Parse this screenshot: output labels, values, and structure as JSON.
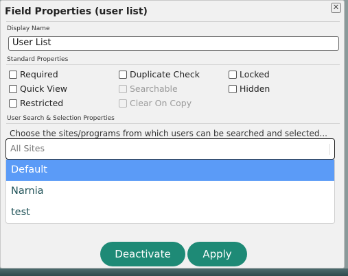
{
  "dialog": {
    "title": "Field Properties (user list)",
    "close_glyph": "✕"
  },
  "display_name": {
    "label": "Display Name",
    "value": "User List"
  },
  "standard_properties": {
    "label": "Standard Properties",
    "options": [
      {
        "label": "Required",
        "checked": false,
        "disabled": false
      },
      {
        "label": "Duplicate Check",
        "checked": false,
        "disabled": false
      },
      {
        "label": "Locked",
        "checked": false,
        "disabled": false
      },
      {
        "label": "Quick View",
        "checked": false,
        "disabled": false
      },
      {
        "label": "Searchable",
        "checked": false,
        "disabled": true
      },
      {
        "label": "Hidden",
        "checked": false,
        "disabled": false
      },
      {
        "label": "Restricted",
        "checked": false,
        "disabled": false
      },
      {
        "label": "Clear On Copy",
        "checked": false,
        "disabled": true
      }
    ]
  },
  "user_search": {
    "label": "User Search & Selection Properties",
    "instructions": "Choose the sites/programs from which users can be searched and selected...",
    "select_placeholder": "All Sites",
    "dropdown_options": [
      {
        "label": "Default",
        "highlighted": true
      },
      {
        "label": "Narnia",
        "highlighted": false
      },
      {
        "label": "test",
        "highlighted": false
      }
    ]
  },
  "buttons": {
    "deactivate": "Deactivate",
    "apply": "Apply"
  },
  "colors": {
    "button_bg": "#1e8a76",
    "option_highlight": "#5b9bf7",
    "option_text": "#1f5257"
  }
}
